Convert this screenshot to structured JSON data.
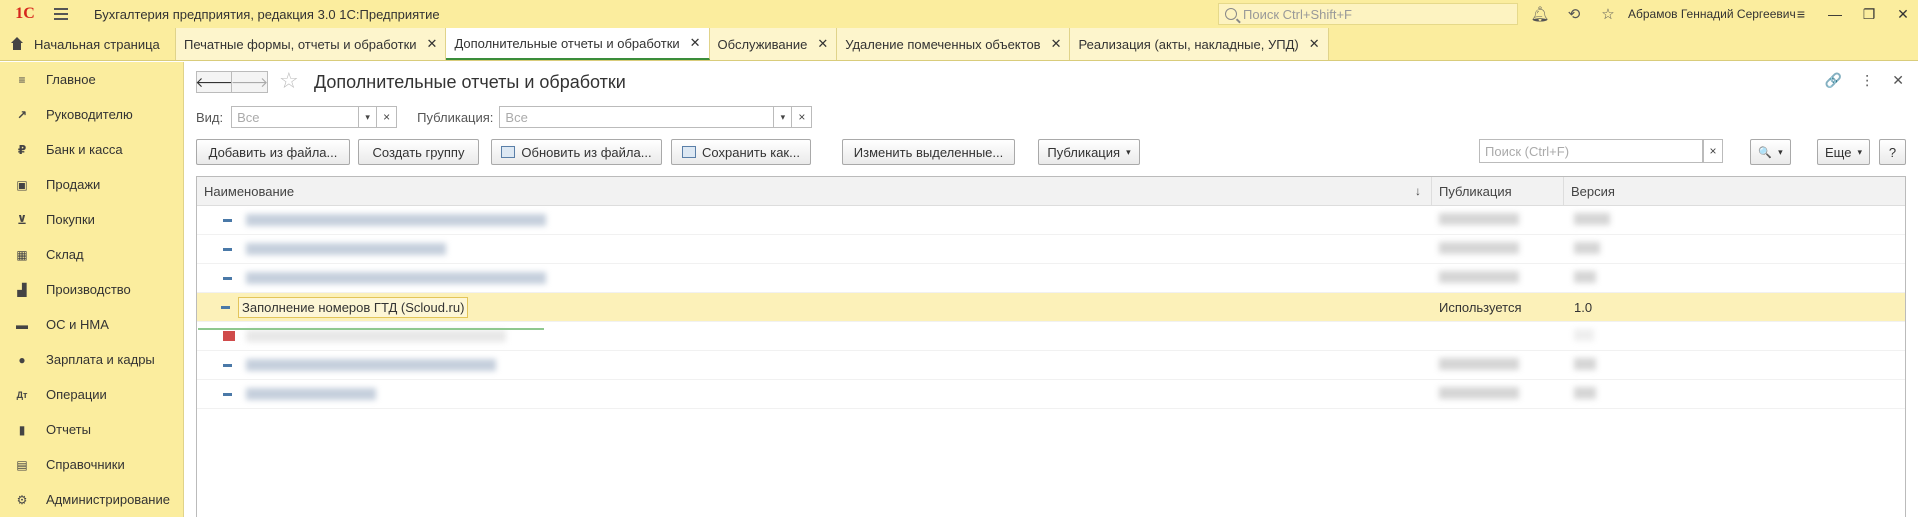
{
  "titlebar": {
    "logo": "1С",
    "app_title": "Бухгалтерия предприятия, редакция 3.0 1С:Предприятие",
    "search_placeholder": "Поиск Ctrl+Shift+F",
    "user": "Абрамов Геннадий Сергеевич",
    "icons": [
      "bell-icon",
      "history-icon",
      "star-icon"
    ],
    "window_controls": [
      "≡",
      "—",
      "❐",
      "✕"
    ]
  },
  "tabs": {
    "home": "Начальная страница",
    "items": [
      {
        "label": "Печатные формы, отчеты и обработки",
        "close": "✕"
      },
      {
        "label": "Дополнительные отчеты и обработки",
        "close": "✕",
        "active": true
      },
      {
        "label": "Обслуживание",
        "close": "✕"
      },
      {
        "label": "Удаление помеченных объектов",
        "close": "✕"
      },
      {
        "label": "Реализация (акты, накладные, УПД)",
        "close": "✕"
      }
    ]
  },
  "sidebar": {
    "items": [
      {
        "label": "Главное",
        "icon": "≡"
      },
      {
        "label": "Руководителю",
        "icon": "↗"
      },
      {
        "label": "Банк и касса",
        "icon": "₽"
      },
      {
        "label": "Продажи",
        "icon": "▣"
      },
      {
        "label": "Покупки",
        "icon": "⊻"
      },
      {
        "label": "Склад",
        "icon": "▦"
      },
      {
        "label": "Производство",
        "icon": "▟"
      },
      {
        "label": "ОС и НМА",
        "icon": "▬"
      },
      {
        "label": "Зарплата и кадры",
        "icon": "●"
      },
      {
        "label": "Операции",
        "icon": "Дт"
      },
      {
        "label": "Отчеты",
        "icon": "▮"
      },
      {
        "label": "Справочники",
        "icon": "▤"
      },
      {
        "label": "Администрирование",
        "icon": "⚙"
      }
    ]
  },
  "main": {
    "back": "🡐",
    "forward": "🡒",
    "star": "☆",
    "title": "Дополнительные отчеты и обработки",
    "top_right": [
      "🔗",
      "⋮",
      "✕"
    ],
    "filters": {
      "vid_label": "Вид:",
      "vid_placeholder": "Все",
      "pub_label": "Публикация:",
      "pub_placeholder": "Все",
      "dd": "▾",
      "clr": "×"
    },
    "commands": {
      "add": "Добавить из файла...",
      "group": "Создать группу",
      "update": "Обновить из файла...",
      "save": "Сохранить как...",
      "change": "Изменить выделенные...",
      "publish": "Публикация",
      "search_placeholder": "Поиск (Ctrl+F)",
      "search_clear": "×",
      "more": "Еще",
      "help": "?",
      "caret": "▾",
      "search_btn": "🔍"
    },
    "table": {
      "headers": {
        "name": "Наименование",
        "pub": "Публикация",
        "ver": "Версия",
        "sort": "↓"
      },
      "rows": [
        {
          "name": "",
          "pub": "",
          "ver": "",
          "blur": true
        },
        {
          "name": "",
          "pub": "",
          "ver": "",
          "blur": true
        },
        {
          "name": "",
          "pub": "",
          "ver": "",
          "blur": true
        },
        {
          "name": "Заполнение номеров ГТД (Scloud.ru)",
          "pub": "Используется",
          "ver": "1.0",
          "selected": true
        },
        {
          "name": "",
          "pub": "",
          "ver": "",
          "blur": true,
          "red": true
        },
        {
          "name": "",
          "pub": "",
          "ver": "",
          "blur": true
        },
        {
          "name": "",
          "pub": "",
          "ver": "",
          "blur": true
        }
      ]
    }
  }
}
